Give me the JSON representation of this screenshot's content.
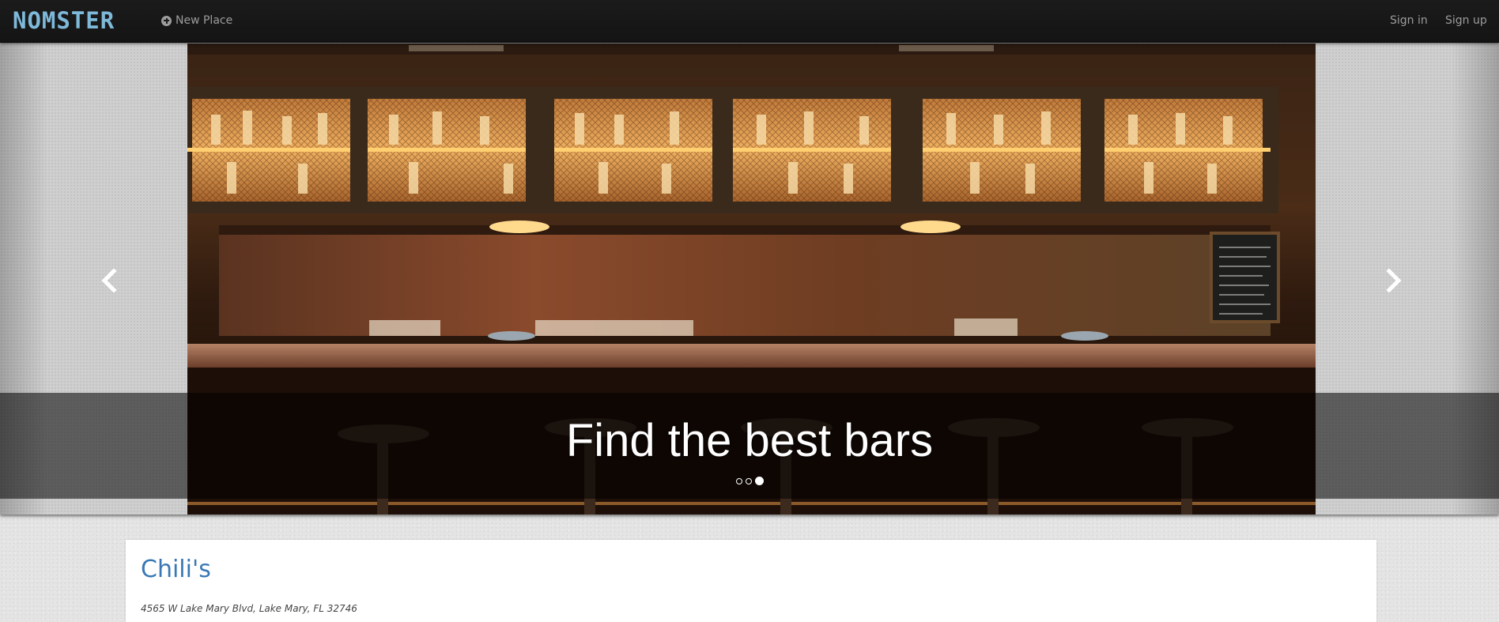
{
  "navbar": {
    "brand": "NOMSTER",
    "new_place": "New Place",
    "sign_in": "Sign in",
    "sign_up": "Sign up"
  },
  "carousel": {
    "caption": "Find the best bars",
    "indicator_count": 3,
    "active_indicator": 3
  },
  "place": {
    "name": "Chili's",
    "address": "4565 W Lake Mary Blvd, Lake Mary, FL 32746"
  },
  "colors": {
    "brand": "#7fb9da",
    "link": "#3a78b5",
    "navbar": "#1a1a1a",
    "nav_text": "#9d9d9d"
  },
  "icons": {
    "new_place": "plus-circle-icon",
    "prev": "chevron-left-icon",
    "next": "chevron-right-icon"
  }
}
